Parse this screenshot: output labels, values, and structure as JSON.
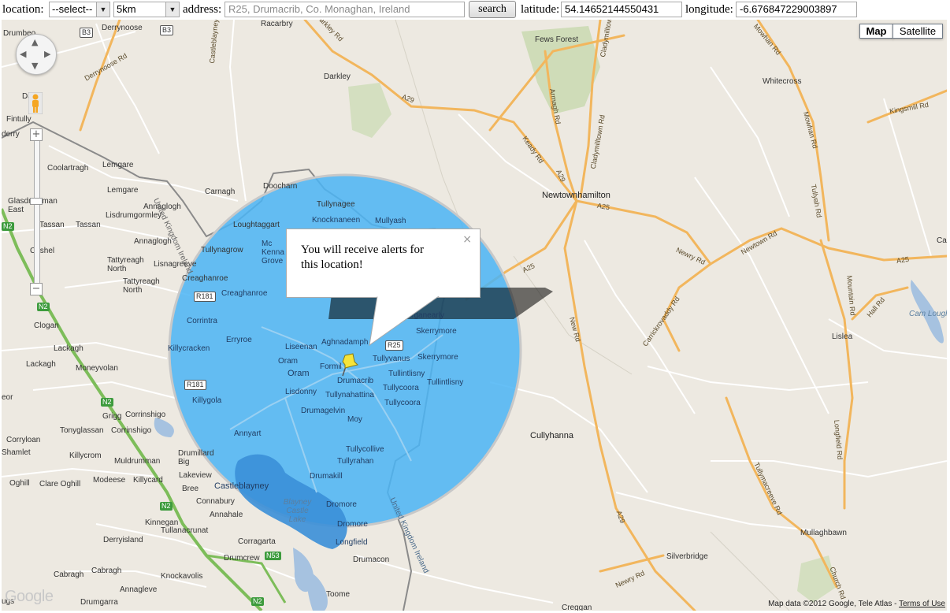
{
  "form": {
    "location_label": "location:",
    "location_value": "--select--",
    "radius_value": "5km",
    "address_label": "address:",
    "address_placeholder": "R25, Drumacrib, Co. Monaghan, Ireland",
    "search_label": "search",
    "latitude_label": "latitude:",
    "latitude_value": "54.14652144550431",
    "longitude_label": "longitude:",
    "longitude_value": "-6.676847229003897"
  },
  "map": {
    "type_map": "Map",
    "type_satellite": "Satellite",
    "google_logo": "Google",
    "footer_text": "Map data ©2012 Google, Tele Atlas -",
    "terms_link": "Terms of Use",
    "alert_radius_km": 5,
    "alert_circle_color": "#4ab4f5",
    "info_window": {
      "message": "You will receive alerts for this location!",
      "close": "×"
    },
    "labels": {
      "drumbeo": "Drumbeo",
      "derrynoose": "Derrynoose",
      "racarbry": "Racarbry",
      "darkley": "Darkley",
      "fews_forest": "Fews Forest",
      "whitecross": "Whitecross",
      "darky": "Darky",
      "fintully": "Fintully",
      "derry": "derry",
      "coolartragh": "Coolartragh",
      "lemgare": "Lemgare",
      "lemgare2": "Lemgare",
      "carnagh": "Carnagh",
      "doocharn": "Doocharn",
      "tullynagee": "Tullynagee",
      "newtownhamilton": "Newtownhamilton",
      "glasdrumman_east": "Glasdrumman East",
      "lisdrumgormley": "Lisdrumgormley",
      "annaglogh": "Annaglogh",
      "annaglogh2": "Annaglogh",
      "tassan": "Tassan",
      "tassan2": "Tassan",
      "loughtaggart": "Loughtaggart",
      "knocknaneen": "Knocknaneen",
      "mullyash": "Mullyash",
      "mc_kenna_grove": "Mc Kenna Grove",
      "cashel": "Cashel",
      "tullynagrow": "Tullynagrow",
      "tattyreagh_north": "Tattyreagh North",
      "lisnagreeve": "Lisnagreeve",
      "creaghanroe": "Creaghanroe",
      "tattyreagh_north2": "Tattyreagh North",
      "creaghanroe2": "Creaghanroe",
      "corrintra": "Corrintra",
      "clogan": "Clogan",
      "erryroe": "Erryroe",
      "liseenan": "Liseenan",
      "aghnadamph": "Aghnadamph",
      "lurganearly": "Lurganearly",
      "skerrymore": "Skerrymore",
      "skerrymore2": "Skerrymore",
      "lackagh": "Lackagh",
      "lackagh2": "Lackagh",
      "killycracken": "Killycracken",
      "moneyvolan": "Moneyvolan",
      "oram": "Oram",
      "oram2": "Oram",
      "formil": "Formil",
      "tullyvanus": "Tullyvanus",
      "tullintlisny": "Tullintlisny",
      "tullintlisny2": "Tullintlisny",
      "drumacrib": "Drumacrib",
      "lisdonny": "Lisdonny",
      "tullynahattina": "Tullynahattina",
      "tullycoora": "Tullycoora",
      "tullycoora2": "Tullycoora",
      "killygola": "Killygola",
      "drumagelvin": "Drumagelvin",
      "moy": "Moy",
      "grigg": "Grigg",
      "corrinshigo": "Corrinshigo",
      "tonyglassan": "Tonyglassan",
      "corrinshigo2": "Corrinshigo",
      "annyart": "Annyart",
      "corryloan": "Corryloan",
      "killycrom": "Killycrom",
      "tullycollive": "Tullycollive",
      "shamlet": "Shamlet",
      "muldrumman": "Muldrumman",
      "drumillard_big": "Drumillard Big",
      "tullyrahan": "Tullyrahan",
      "oghill": "Oghill",
      "clare_oghill": "Clare Oghill",
      "modeese": "Modeese",
      "killycard": "Killycard",
      "drumakill": "Drumakill",
      "lakeview": "Lakeview",
      "bree": "Bree",
      "castleblayney": "Castleblayney",
      "blayney_castle_lake": "Blayney Castle Lake",
      "connabury": "Connabury",
      "dromore": "Dromore",
      "dromore2": "Dromore",
      "annahale": "Annahale",
      "kinnegan": "Kinnegan",
      "tullanacrunat": "Tullanacrunat",
      "derryisland": "Derryisland",
      "corragarta": "Corragarta",
      "longfield": "Longfield",
      "drumcrew": "Drumcrew",
      "drumacon": "Drumacon",
      "cabragh": "Cabragh",
      "cabragh2": "Cabragh",
      "knockavolis": "Knockavolis",
      "annagleve": "Annagleve",
      "drumgarra": "Drumgarra",
      "toome": "Toome",
      "cullyhanna": "Cullyhanna",
      "lislea": "Lislea",
      "cam_lough": "Cam Lough",
      "mullaghbawn": "Mullaghbawn",
      "silverbridge": "Silverbridge",
      "creggan": "Creggan",
      "ca": "Ca",
      "ugs": "ugs",
      "eor": "eor",
      "united_kingdom_ireland": "United Kingdom Ireland",
      "united_kingdom_ireland2": "United Kingdom Ireland"
    },
    "roads": {
      "a29": "A29",
      "a29b": "A29",
      "a29c": "A29",
      "a25": "A25",
      "a25b": "A25",
      "a25c": "A25",
      "b3": "B3",
      "b3b": "B3",
      "r181": "R181",
      "r181b": "R181",
      "r25": "R25",
      "n2": "N2",
      "n2b": "N2",
      "n2c": "N2",
      "n2d": "N2",
      "n2e": "N2",
      "n53": "N53",
      "derrynoose_rd": "Derrynoose Rd",
      "castleblayney_rd": "Castleblayney Rd",
      "darkley_rd": "Darkley Rd",
      "keady_rd": "Keady Rd",
      "armagh_rd": "Armagh Rd",
      "cladymilltown_rd": "Cladymilltown Rd",
      "mowhan_rd": "Mowhan Rd",
      "mowhan_rd2": "Mowhan Rd",
      "kingsmill_rd": "Kingsmill Rd",
      "tullyah_rd": "Tullyah Rd",
      "newry_rd": "Newry Rd",
      "newtown_rd": "Newtown Rd",
      "new_rd": "New Rd",
      "carrickrovaddy_rd": "Carrickrovaddy Rd",
      "mountain_rd": "Mountain Rd",
      "hall_rd": "Hall Rd",
      "longfield_rd": "Longfield Rd",
      "tullymacreeve_rd": "Tullymacreeve Rd",
      "church_rd": "Church Rd",
      "newry_rd2": "Newry Rd",
      "cladymilltown_rd2": "Cladymilltown Rd",
      "cladymilltown_rd3": "Cladymilltown"
    }
  }
}
